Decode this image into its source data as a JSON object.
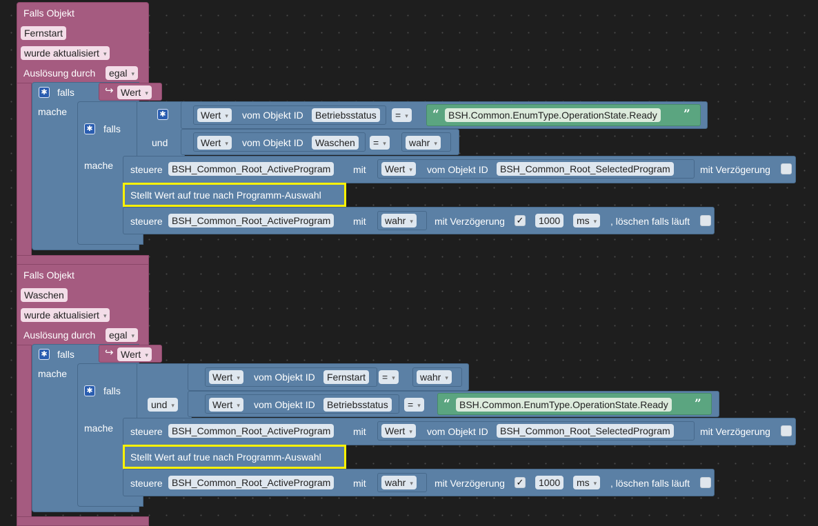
{
  "blocks": [
    {
      "header": "Falls Objekt",
      "object": "Fernstart",
      "trigger": "wurde aktualisiert",
      "by_label": "Auslösung durch",
      "by_value": "egal",
      "outer_if": "falls",
      "outer_then": "mache",
      "cond_value": "Wert",
      "inner_if": "falls",
      "inner_then": "mache",
      "join": "und",
      "cond1": {
        "prop": "Wert",
        "from": "vom Objekt ID",
        "obj": "Betriebsstatus",
        "op": "=",
        "string": "BSH.Common.EnumType.OperationState.Ready"
      },
      "cond2": {
        "prop": "Wert",
        "from": "vom Objekt ID",
        "obj": "Waschen",
        "op": "=",
        "value": "wahr"
      },
      "act1": {
        "verb": "steuere",
        "target": "BSH_Common_Root_ActiveProgram",
        "with": "mit",
        "prop": "Wert",
        "from": "vom Objekt ID",
        "source": "BSH_Common_Root_SelectedProgram",
        "delay_label": "mit Verzögerung"
      },
      "comment": "Stellt Wert auf true nach Programm-Auswahl",
      "act2": {
        "verb": "steuere",
        "target": "BSH_Common_Root_ActiveProgram",
        "with": "mit",
        "value": "wahr",
        "delay_label": "mit Verzögerung",
        "delay_check": "✓",
        "delay": "1000",
        "unit": "ms",
        "clear_label": ", löschen falls läuft"
      }
    },
    {
      "header": "Falls Objekt",
      "object": "Waschen",
      "trigger": "wurde aktualisiert",
      "by_label": "Auslösung durch",
      "by_value": "egal",
      "outer_if": "falls",
      "outer_then": "mache",
      "cond_value": "Wert",
      "inner_if": "falls",
      "inner_then": "mache",
      "join": "und",
      "cond1": {
        "prop": "Wert",
        "from": "vom Objekt ID",
        "obj": "Fernstart",
        "op": "=",
        "value": "wahr"
      },
      "cond2": {
        "prop": "Wert",
        "from": "vom Objekt ID",
        "obj": "Betriebsstatus",
        "op": "=",
        "string": "BSH.Common.EnumType.OperationState.Ready"
      },
      "act1": {
        "verb": "steuere",
        "target": "BSH_Common_Root_ActiveProgram",
        "with": "mit",
        "prop": "Wert",
        "from": "vom Objekt ID",
        "source": "BSH_Common_Root_SelectedProgram",
        "delay_label": "mit Verzögerung"
      },
      "comment": "Stellt Wert auf true nach Programm-Auswahl",
      "act2": {
        "verb": "steuere",
        "target": "BSH_Common_Root_ActiveProgram",
        "with": "mit",
        "value": "wahr",
        "delay_label": "mit Verzögerung",
        "delay_check": "✓",
        "delay": "1000",
        "unit": "ms",
        "clear_label": ", löschen falls läuft"
      }
    }
  ],
  "icons": {
    "settings": "gear-icon",
    "arrow": "return-arrow-icon",
    "dropdown": "dropdown-arrow-icon",
    "quote_open": "“",
    "quote_close": "”"
  },
  "colors": {
    "event": "#a55b80",
    "logic": "#5b80a5",
    "string": "#5ba580",
    "comment": "#fff200",
    "workspace": "#1e1e1e"
  }
}
